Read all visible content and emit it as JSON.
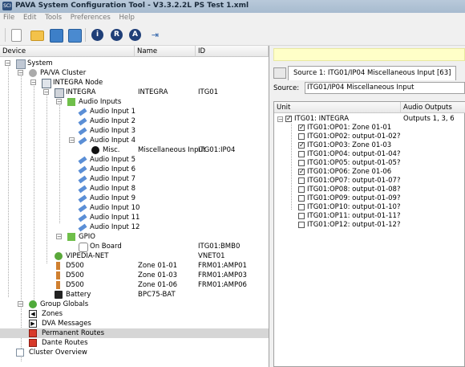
{
  "window": {
    "title": "PAVA System Configuration Tool - V3.3.2.2L PS Test 1.xml"
  },
  "menu": [
    "File",
    "Edit",
    "Tools",
    "Preferences",
    "Help"
  ],
  "toolbar": {
    "icons": [
      "new-file-icon",
      "open-folder-icon",
      "save-icon",
      "save-as-icon",
      "info-icon",
      "r-icon",
      "a-icon",
      "pin-icon"
    ]
  },
  "tree": {
    "headers": {
      "device": "Device",
      "name": "Name",
      "id": "ID"
    },
    "rows": [
      {
        "label": "System",
        "name": "",
        "id": ""
      },
      {
        "label": "PA/VA Cluster",
        "name": "",
        "id": ""
      },
      {
        "label": "INTEGRA Node",
        "name": "",
        "id": ""
      },
      {
        "label": "INTEGRA",
        "name": "INTEGRA",
        "id": "ITG01"
      },
      {
        "label": "Audio Inputs",
        "name": "",
        "id": ""
      },
      {
        "label": "Audio Input 1",
        "name": "",
        "id": ""
      },
      {
        "label": "Audio Input 2",
        "name": "",
        "id": ""
      },
      {
        "label": "Audio Input 3",
        "name": "",
        "id": ""
      },
      {
        "label": "Audio Input 4",
        "name": "",
        "id": ""
      },
      {
        "label": "Misc.",
        "name": "Miscellaneous Input",
        "id": "ITG01:IP04"
      },
      {
        "label": "Audio Input 5",
        "name": "",
        "id": ""
      },
      {
        "label": "Audio Input 6",
        "name": "",
        "id": ""
      },
      {
        "label": "Audio Input 7",
        "name": "",
        "id": ""
      },
      {
        "label": "Audio Input 8",
        "name": "",
        "id": ""
      },
      {
        "label": "Audio Input 9",
        "name": "",
        "id": ""
      },
      {
        "label": "Audio Input 10",
        "name": "",
        "id": ""
      },
      {
        "label": "Audio Input 11",
        "name": "",
        "id": ""
      },
      {
        "label": "Audio Input 12",
        "name": "",
        "id": ""
      },
      {
        "label": "GPIO",
        "name": "",
        "id": ""
      },
      {
        "label": "On Board",
        "name": "",
        "id": "ITG01:BMB0"
      },
      {
        "label": "VIPEDIA-NET",
        "name": "",
        "id": "VNET01"
      },
      {
        "label": "D500",
        "name": "Zone 01-01",
        "id": "FRM01:AMP01"
      },
      {
        "label": "D500",
        "name": "Zone 01-03",
        "id": "FRM01:AMP03"
      },
      {
        "label": "D500",
        "name": "Zone 01-06",
        "id": "FRM01:AMP06"
      },
      {
        "label": "Battery",
        "name": "BPC75-BAT",
        "id": ""
      },
      {
        "label": "Group Globals",
        "name": "",
        "id": ""
      },
      {
        "label": "Zones",
        "name": "",
        "id": ""
      },
      {
        "label": "DVA Messages",
        "name": "",
        "id": ""
      },
      {
        "label": "Permanent Routes",
        "name": "",
        "id": ""
      },
      {
        "label": "Dante Routes",
        "name": "",
        "id": ""
      },
      {
        "label": "Cluster Overview",
        "name": "",
        "id": ""
      }
    ]
  },
  "detail": {
    "tab_label": "Source 1: ITG01/IP04 Miscellaneous Input [63]",
    "source_label": "Source:",
    "source_value": "ITG01/IP04 Miscellaneous Input",
    "headers": {
      "unit": "Unit",
      "outputs": "Audio Outputs"
    },
    "root": {
      "label": "ITG01: INTEGRA",
      "outputs": "Outputs 1, 3, 6",
      "checked": true
    },
    "outputs": [
      {
        "label": "ITG01:OP01: Zone 01-01",
        "checked": true
      },
      {
        "label": "ITG01:OP02: output-01-02?",
        "checked": false
      },
      {
        "label": "ITG01:OP03: Zone 01-03",
        "checked": true
      },
      {
        "label": "ITG01:OP04: output-01-04?",
        "checked": false
      },
      {
        "label": "ITG01:OP05: output-01-05?",
        "checked": false
      },
      {
        "label": "ITG01:OP06: Zone 01-06",
        "checked": true
      },
      {
        "label": "ITG01:OP07: output-01-07?",
        "checked": false
      },
      {
        "label": "ITG01:OP08: output-01-08?",
        "checked": false
      },
      {
        "label": "ITG01:OP09: output-01-09?",
        "checked": false
      },
      {
        "label": "ITG01:OP10: output-01-10?",
        "checked": false
      },
      {
        "label": "ITG01:OP11: output-01-11?",
        "checked": false
      },
      {
        "label": "ITG01:OP12: output-01-12?",
        "checked": false
      }
    ]
  }
}
